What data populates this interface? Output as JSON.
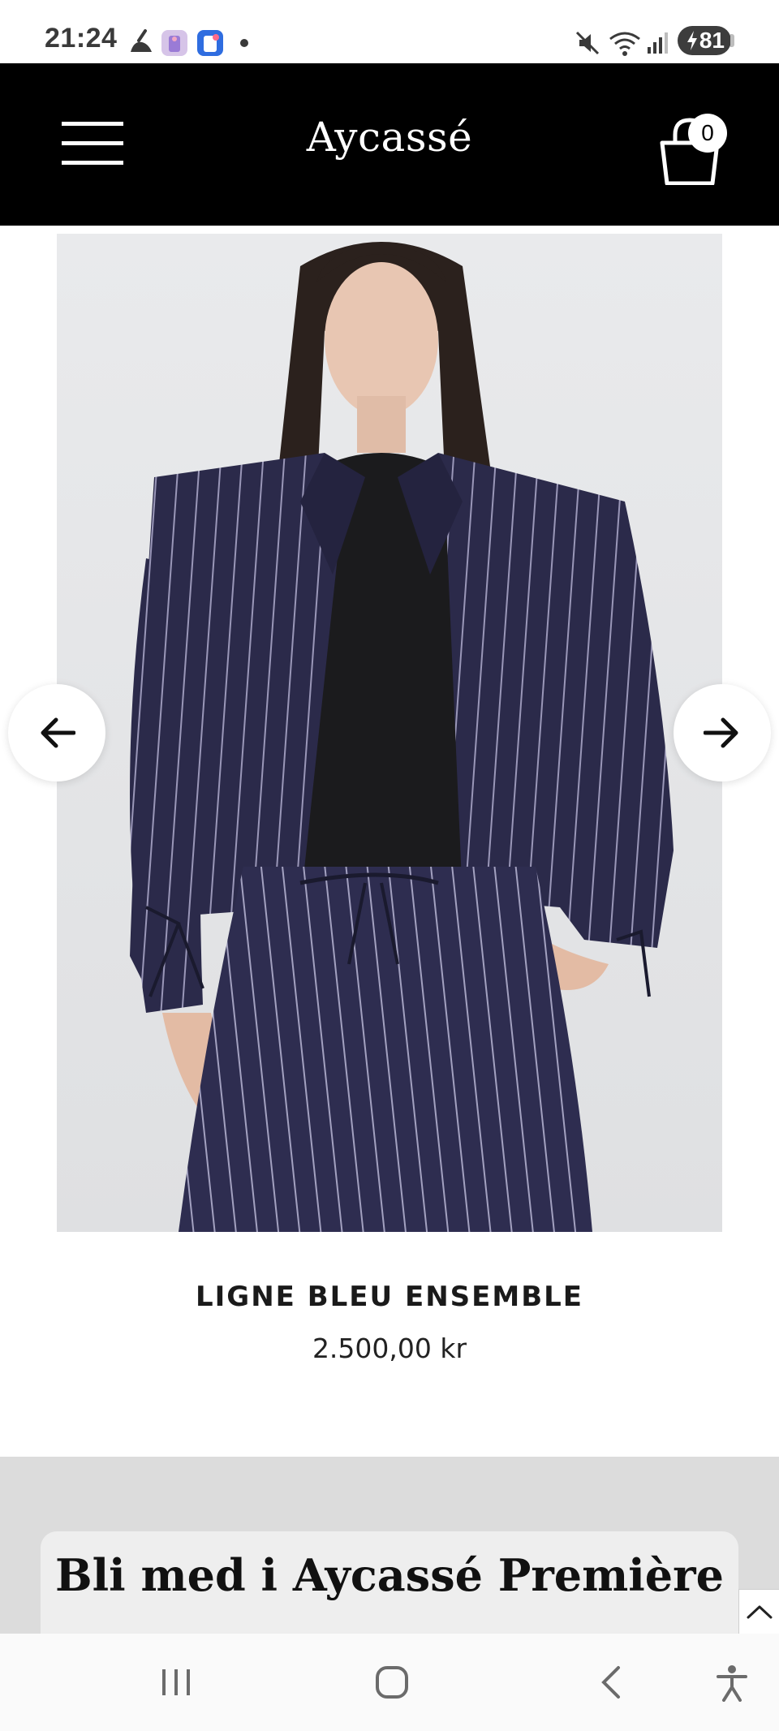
{
  "status_bar": {
    "time": "21:24",
    "battery": "81",
    "icons_left": [
      "broom-icon",
      "app-notification-icon",
      "app-notification-icon-2",
      "dot-icon"
    ],
    "icons_right": [
      "mute-icon",
      "wifi-icon",
      "signal-icon",
      "battery-icon"
    ]
  },
  "header": {
    "brand": "Aycassé",
    "cart_count": "0",
    "background": "#000000"
  },
  "product": {
    "title": "LIGNE BLEU ENSEMBLE",
    "price": "2.500,00 kr",
    "image_icon": "product-photo"
  },
  "carousel": {
    "prev_icon": "arrow-left-icon",
    "next_icon": "arrow-right-icon"
  },
  "newsletter": {
    "heading": "Bli med i Aycassé Première",
    "section_bg": "#dcdcdc"
  },
  "navigation_bar": {
    "items": [
      "recent-apps-icon",
      "home-icon",
      "back-icon",
      "accessibility-icon"
    ]
  }
}
